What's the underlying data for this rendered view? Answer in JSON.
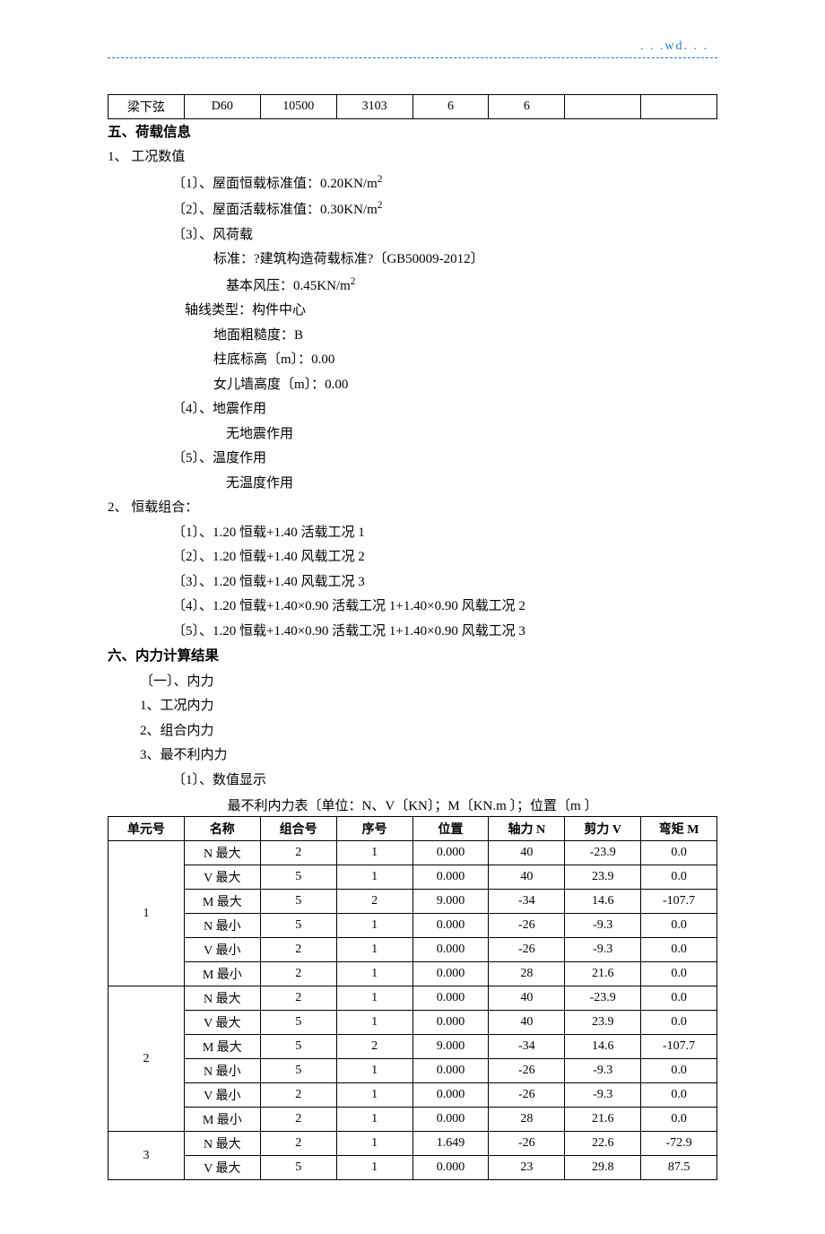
{
  "header_trail": ". . .wd. . .",
  "top_table": {
    "cells": [
      "梁下弦",
      "D60",
      "10500",
      "3103",
      "6",
      "6",
      "",
      ""
    ]
  },
  "sec5": {
    "title": "五、荷载信息",
    "p1": "1、 工况数值",
    "i1": "〔1〕、屋面恒载标准值：0.20KN/m",
    "i2": "〔2〕、屋面活载标准值：0.30KN/m",
    "i3": "〔3〕、风荷载",
    "i3a": "标准：?建筑构造荷载标准?〔GB50009-2012〕",
    "i3b": "基本风压：0.45KN/m",
    "axis": "轴线类型：构件中心",
    "rough": "地面粗糙度：B",
    "base": "柱底标高〔m〕：0.00",
    "parapet": "女儿墙高度〔m〕：0.00",
    "i4": "〔4〕、地震作用",
    "i4a": "无地震作用",
    "i5": "〔5〕、温度作用",
    "i5a": "无温度作用",
    "p2": "2、 恒载组合：",
    "c1": "〔1〕、1.20 恒载+1.40 活载工况 1",
    "c2": "〔2〕、1.20 恒载+1.40 风载工况 2",
    "c3": "〔3〕、1.20 恒载+1.40 风载工况 3",
    "c4": "〔4〕、1.20 恒载+1.40×0.90 活载工况 1+1.40×0.90 风载工况 2",
    "c5": "〔5〕、1.20 恒载+1.40×0.90 活载工况 1+1.40×0.90 风载工况 3"
  },
  "sec6": {
    "title": "六、内力计算结果",
    "a": "〔一〕、内力",
    "a1": "1、工况内力",
    "a2": "2、组合内力",
    "a3": "3、最不利内力",
    "a3a": "〔1〕、数值显示",
    "caption": "最不利内力表〔单位：N、V〔KN〕；M〔KN.m 〕；位置〔m 〕"
  },
  "force_table": {
    "headers": [
      "单元号",
      "名称",
      "组合号",
      "序号",
      "位置",
      "轴力 N",
      "剪力 V",
      "弯矩 M"
    ],
    "groups": [
      {
        "unit": "1",
        "rows": [
          [
            "N 最大",
            "2",
            "1",
            "0.000",
            "40",
            "-23.9",
            "0.0"
          ],
          [
            "V 最大",
            "5",
            "1",
            "0.000",
            "40",
            "23.9",
            "0.0"
          ],
          [
            "M 最大",
            "5",
            "2",
            "9.000",
            "-34",
            "14.6",
            "-107.7"
          ],
          [
            "N 最小",
            "5",
            "1",
            "0.000",
            "-26",
            "-9.3",
            "0.0"
          ],
          [
            "V 最小",
            "2",
            "1",
            "0.000",
            "-26",
            "-9.3",
            "0.0"
          ],
          [
            "M 最小",
            "2",
            "1",
            "0.000",
            "28",
            "21.6",
            "0.0"
          ]
        ]
      },
      {
        "unit": "2",
        "rows": [
          [
            "N 最大",
            "2",
            "1",
            "0.000",
            "40",
            "-23.9",
            "0.0"
          ],
          [
            "V 最大",
            "5",
            "1",
            "0.000",
            "40",
            "23.9",
            "0.0"
          ],
          [
            "M 最大",
            "5",
            "2",
            "9.000",
            "-34",
            "14.6",
            "-107.7"
          ],
          [
            "N 最小",
            "5",
            "1",
            "0.000",
            "-26",
            "-9.3",
            "0.0"
          ],
          [
            "V 最小",
            "2",
            "1",
            "0.000",
            "-26",
            "-9.3",
            "0.0"
          ],
          [
            "M 最小",
            "2",
            "1",
            "0.000",
            "28",
            "21.6",
            "0.0"
          ]
        ]
      },
      {
        "unit": "3",
        "rows": [
          [
            "N 最大",
            "2",
            "1",
            "1.649",
            "-26",
            "22.6",
            "-72.9"
          ],
          [
            "V 最大",
            "5",
            "1",
            "0.000",
            "23",
            "29.8",
            "87.5"
          ]
        ]
      }
    ]
  }
}
